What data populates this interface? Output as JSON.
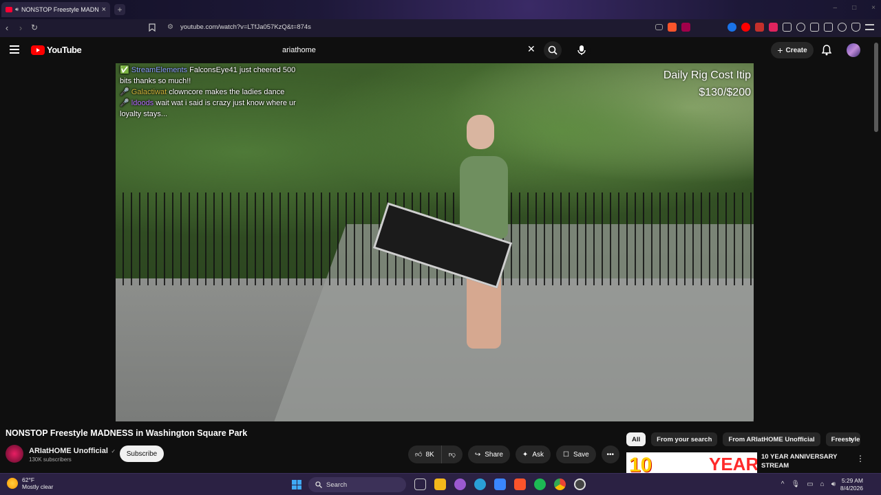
{
  "browser": {
    "tab_title": "NONSTOP Freestyle MADNESS",
    "new_tab": "+",
    "url": "youtube.com/watch?v=LTfJa057KzQ&t=874s"
  },
  "youtube": {
    "logo_text": "YouTube",
    "search_query": "ariathome",
    "create_label": "Create"
  },
  "video": {
    "chat": [
      {
        "user": "StreamElements",
        "message": "FalconsEye41 just cheered 500 bits thanks so much!!"
      },
      {
        "user": "Galactiwat",
        "message": "clowncore makes the ladies dance"
      },
      {
        "user": "ldoods",
        "message": "wait wat i said is crazy just know where ur loyalty stays..."
      }
    ],
    "overlay_line1": "Daily Rig Cost Itip",
    "overlay_line2": "$130/$200"
  },
  "watch": {
    "title": "NONSTOP Freestyle MADNESS in Washington Square Park",
    "channel_name": "ARIatHOME Unofficial",
    "verified_icon": "✓",
    "subscribers": "130K subscribers",
    "subscribe_label": "Subscribe",
    "like_count": "8K",
    "share_label": "Share",
    "ask_label": "Ask",
    "save_label": "Save"
  },
  "chips": [
    "All",
    "From your search",
    "From ARIatHOME Unofficial",
    "Freestyle"
  ],
  "recommendation": {
    "thumb_text_1": "10",
    "thumb_text_2": "YEAR",
    "title": "10 YEAR ANNIVERSARY STREAM"
  },
  "taskbar": {
    "temp": "62°F",
    "weather": "Mostly clear",
    "search_label": "Search",
    "time": "5:29 AM",
    "date": "8/4/2026"
  },
  "colors": {
    "accent": "#ff0000",
    "bg": "#0f0f0f",
    "taskbar": "#2b2143"
  }
}
